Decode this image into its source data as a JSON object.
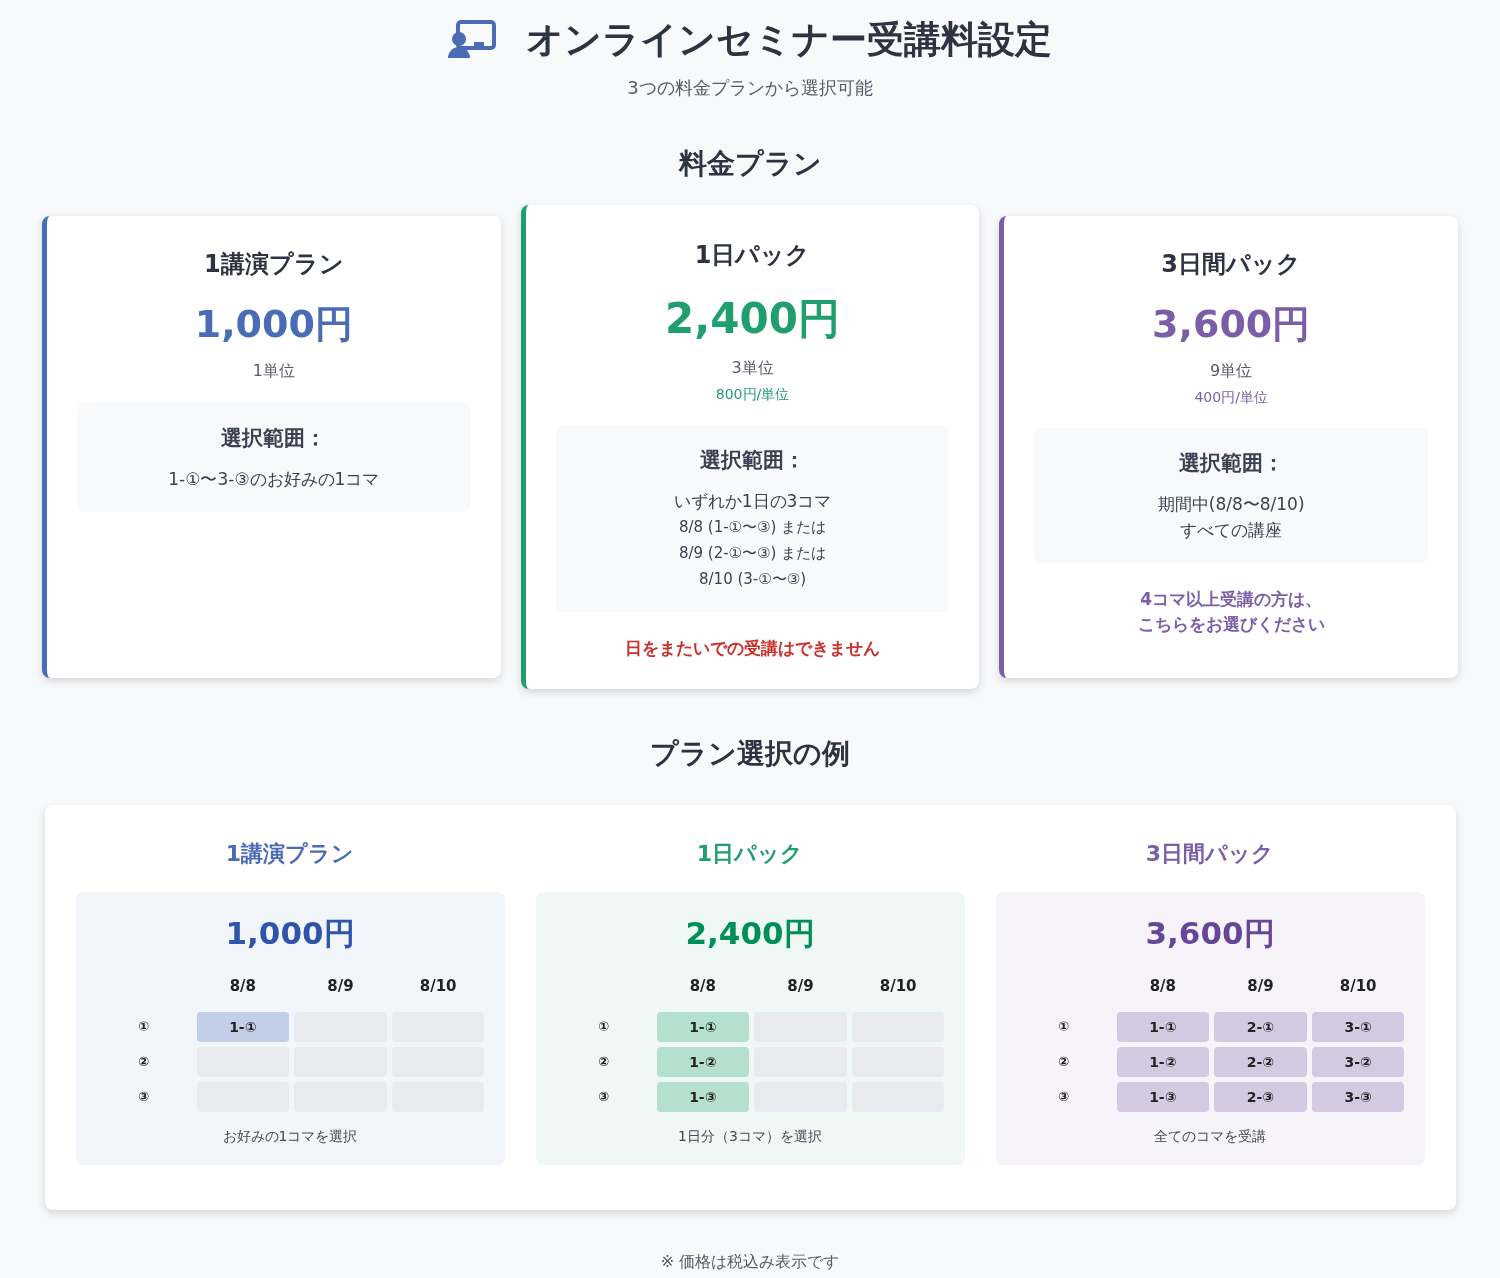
{
  "header": {
    "title": "オンラインセミナー受講料設定",
    "subtitle": "3つの料金プランから選択可能"
  },
  "plans_heading": "料金プラン",
  "plans": [
    {
      "name": "1講演プラン",
      "price": "1,000円",
      "units": "1単位",
      "color": "#4a6bb5",
      "featured": false,
      "range_title": "選択範囲：",
      "range_lines": [
        {
          "kind": "main",
          "text": "1-①〜3-③のお好みの1コマ"
        }
      ]
    },
    {
      "name": "1日パック",
      "price": "2,400円",
      "units": "3単位",
      "per_unit": "800円/単位",
      "color": "#1f9e6e",
      "featured": true,
      "range_title": "選択範囲：",
      "range_lines": [
        {
          "kind": "main",
          "text": "いずれか1日の3コマ"
        },
        {
          "kind": "sub",
          "text": "8/8 (1-①〜③) または"
        },
        {
          "kind": "sub",
          "text": "8/9 (2-①〜③) または"
        },
        {
          "kind": "sub",
          "text": "8/10 (3-①〜③)"
        }
      ],
      "note": {
        "kind": "warning",
        "lines": [
          "日をまたいでの受講はできません"
        ]
      }
    },
    {
      "name": "3日間パック",
      "price": "3,600円",
      "units": "9単位",
      "per_unit": "400円/単位",
      "color": "#7b5ea7",
      "featured": false,
      "range_title": "選択範囲：",
      "range_lines": [
        {
          "kind": "main",
          "text": "期間中(8/8〜8/10)"
        },
        {
          "kind": "main",
          "text": "すべての講座"
        }
      ],
      "note": {
        "kind": "info",
        "lines": [
          "4コマ以上受講の方は、",
          "こちらをお選びください"
        ]
      }
    }
  ],
  "examples_heading": "プラン選択の例",
  "examples": [
    {
      "title": "1講演プラン",
      "price": "1,000円",
      "color": "#4a6bb5",
      "columns": [
        "8/8",
        "8/9",
        "8/10"
      ],
      "rows": [
        {
          "label": "①",
          "cells": [
            {
              "text": "1-①",
              "selected": true
            },
            {
              "selected": false
            },
            {
              "selected": false
            }
          ]
        },
        {
          "label": "②",
          "cells": [
            {
              "selected": false
            },
            {
              "selected": false
            },
            {
              "selected": false
            }
          ]
        },
        {
          "label": "③",
          "cells": [
            {
              "selected": false
            },
            {
              "selected": false
            },
            {
              "selected": false
            }
          ]
        }
      ],
      "caption": "お好みの1コマを選択"
    },
    {
      "title": "1日パック",
      "price": "2,400円",
      "color": "#1f9e6e",
      "columns": [
        "8/8",
        "8/9",
        "8/10"
      ],
      "rows": [
        {
          "label": "①",
          "cells": [
            {
              "text": "1-①",
              "selected": true
            },
            {
              "selected": false
            },
            {
              "selected": false
            }
          ]
        },
        {
          "label": "②",
          "cells": [
            {
              "text": "1-②",
              "selected": true
            },
            {
              "selected": false
            },
            {
              "selected": false
            }
          ]
        },
        {
          "label": "③",
          "cells": [
            {
              "text": "1-③",
              "selected": true
            },
            {
              "selected": false
            },
            {
              "selected": false
            }
          ]
        }
      ],
      "caption": "1日分（3コマ）を選択"
    },
    {
      "title": "3日間パック",
      "price": "3,600円",
      "color": "#7b5ea7",
      "columns": [
        "8/8",
        "8/9",
        "8/10"
      ],
      "rows": [
        {
          "label": "①",
          "cells": [
            {
              "text": "1-①",
              "selected": true
            },
            {
              "text": "2-①",
              "selected": true
            },
            {
              "text": "3-①",
              "selected": true
            }
          ]
        },
        {
          "label": "②",
          "cells": [
            {
              "text": "1-②",
              "selected": true
            },
            {
              "text": "2-②",
              "selected": true
            },
            {
              "text": "3-②",
              "selected": true
            }
          ]
        },
        {
          "label": "③",
          "cells": [
            {
              "text": "1-③",
              "selected": true
            },
            {
              "text": "2-③",
              "selected": true
            },
            {
              "text": "3-③",
              "selected": true
            }
          ]
        }
      ],
      "caption": "全てのコマを受講"
    }
  ],
  "footer_note": "※ 価格は税込み表示です"
}
